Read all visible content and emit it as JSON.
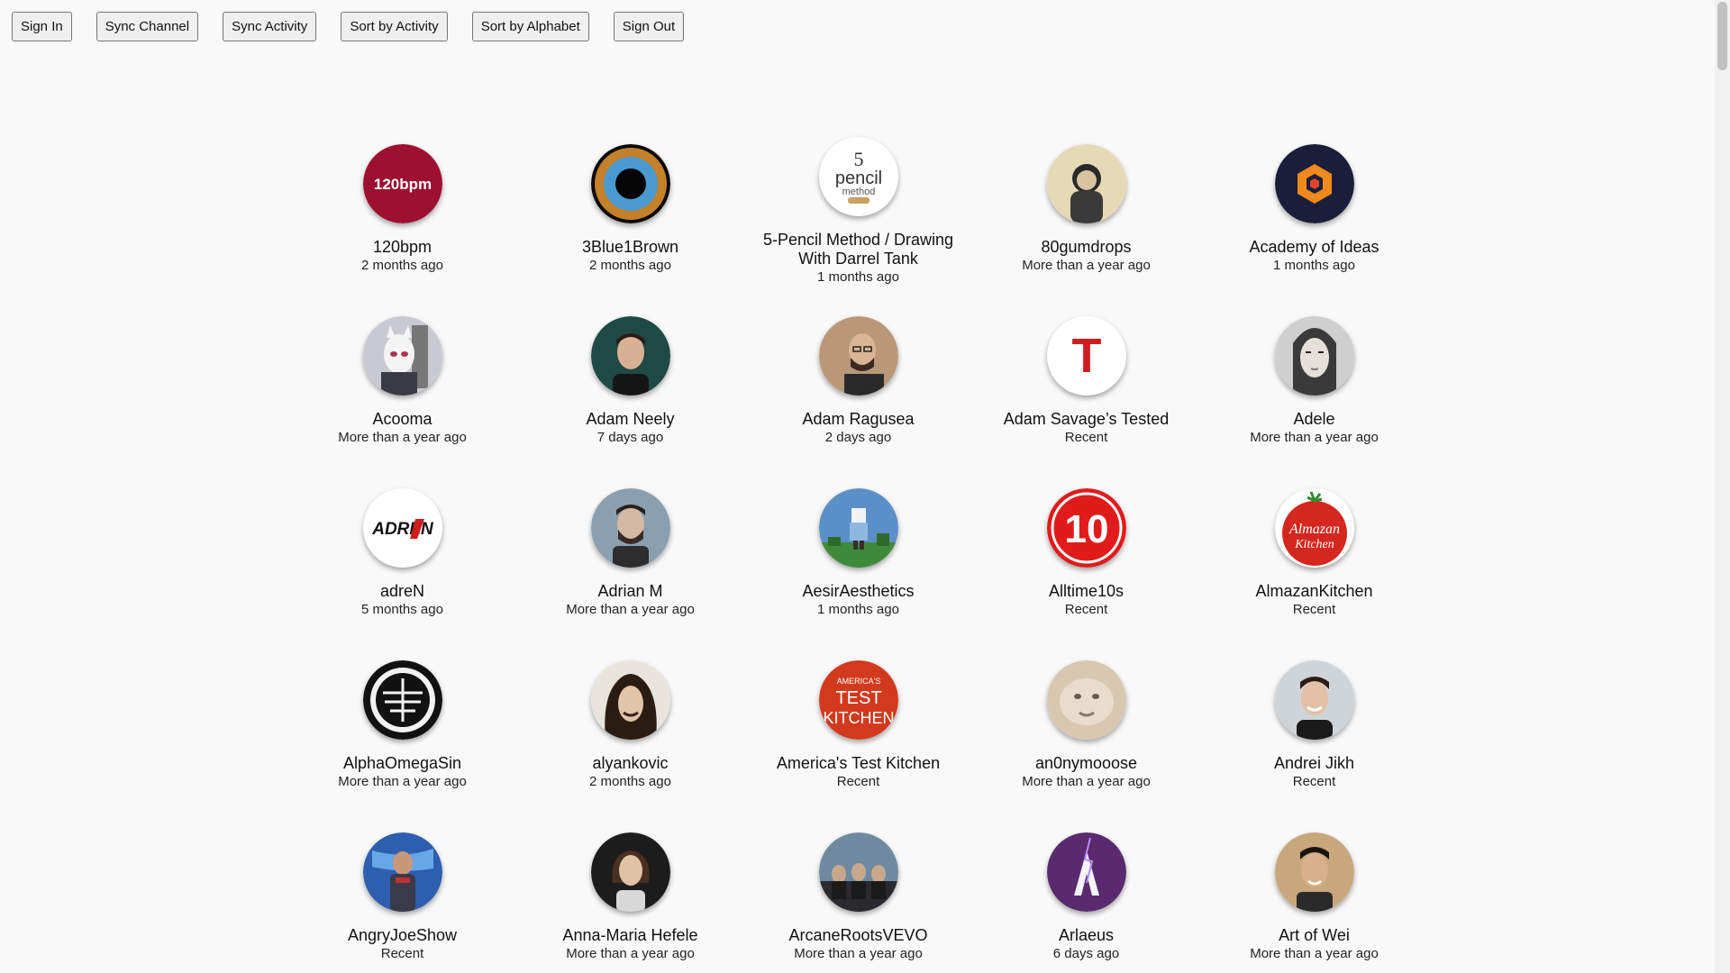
{
  "toolbar": {
    "sign_in": "Sign In",
    "sync_channel": "Sync Channel",
    "sync_activity": "Sync Activity",
    "sort_activity": "Sort by Activity",
    "sort_alphabet": "Sort by Alphabet",
    "sign_out": "Sign Out"
  },
  "channels": [
    {
      "name": "120bpm",
      "time": "2 months ago",
      "avatar_color": "#9c1030",
      "avatar_text": "120bpm"
    },
    {
      "name": "3Blue1Brown",
      "time": "2 months ago",
      "avatar_color": "#3a7ab8"
    },
    {
      "name": "5-Pencil Method / Drawing With Darrel Tank",
      "time": "1 months ago",
      "avatar_color": "#ffffff",
      "avatar_text": "5 pencil method"
    },
    {
      "name": "80gumdrops",
      "time": "More than a year ago",
      "avatar_color": "#e6d9b5"
    },
    {
      "name": "Academy of Ideas",
      "time": "1 months ago",
      "avatar_color": "#1a1e3a"
    },
    {
      "name": "Acooma",
      "time": "More than a year ago",
      "avatar_color": "#c9c9d2"
    },
    {
      "name": "Adam Neely",
      "time": "7 days ago",
      "avatar_color": "#1f4a44"
    },
    {
      "name": "Adam Ragusea",
      "time": "2 days ago",
      "avatar_color": "#b99878"
    },
    {
      "name": "Adam Savage’s Tested",
      "time": "Recent",
      "avatar_color": "#ffffff",
      "avatar_text": "T"
    },
    {
      "name": "Adele",
      "time": "More than a year ago",
      "avatar_color": "#8a8a8a"
    },
    {
      "name": "adreN",
      "time": "5 months ago",
      "avatar_color": "#ffffff",
      "avatar_text": "ADREN"
    },
    {
      "name": "Adrian M",
      "time": "More than a year ago",
      "avatar_color": "#8aa0b0"
    },
    {
      "name": "AesirAesthetics",
      "time": "1 months ago",
      "avatar_color": "#5b8fc7"
    },
    {
      "name": "Alltime10s",
      "time": "Recent",
      "avatar_color": "#e01b1b",
      "avatar_text": "10"
    },
    {
      "name": "AlmazanKitchen",
      "time": "Recent",
      "avatar_color": "#d4271f",
      "avatar_text": "Almazan Kitchen"
    },
    {
      "name": "AlphaOmegaSin",
      "time": "More than a year ago",
      "avatar_color": "#111111"
    },
    {
      "name": "alyankovic",
      "time": "2 months ago",
      "avatar_color": "#e9e4dc"
    },
    {
      "name": "America's Test Kitchen",
      "time": "Recent",
      "avatar_color": "#d23a1d",
      "avatar_text": "AMERICA'S TEST KITCHEN"
    },
    {
      "name": "an0nymooose",
      "time": "More than a year ago",
      "avatar_color": "#d9c8b0"
    },
    {
      "name": "Andrei Jikh",
      "time": "Recent",
      "avatar_color": "#cfd4d8"
    },
    {
      "name": "AngryJoeShow",
      "time": "Recent",
      "avatar_color": "#2d5fae"
    },
    {
      "name": "Anna-Maria Hefele",
      "time": "More than a year ago",
      "avatar_color": "#1c1c1c"
    },
    {
      "name": "ArcaneRootsVEVO",
      "time": "More than a year ago",
      "avatar_color": "#6f8aa0"
    },
    {
      "name": "Arlaeus",
      "time": "6 days ago",
      "avatar_color": "#5a2a6e"
    },
    {
      "name": "Art of Wei",
      "time": "More than a year ago",
      "avatar_color": "#c9a77c"
    }
  ]
}
